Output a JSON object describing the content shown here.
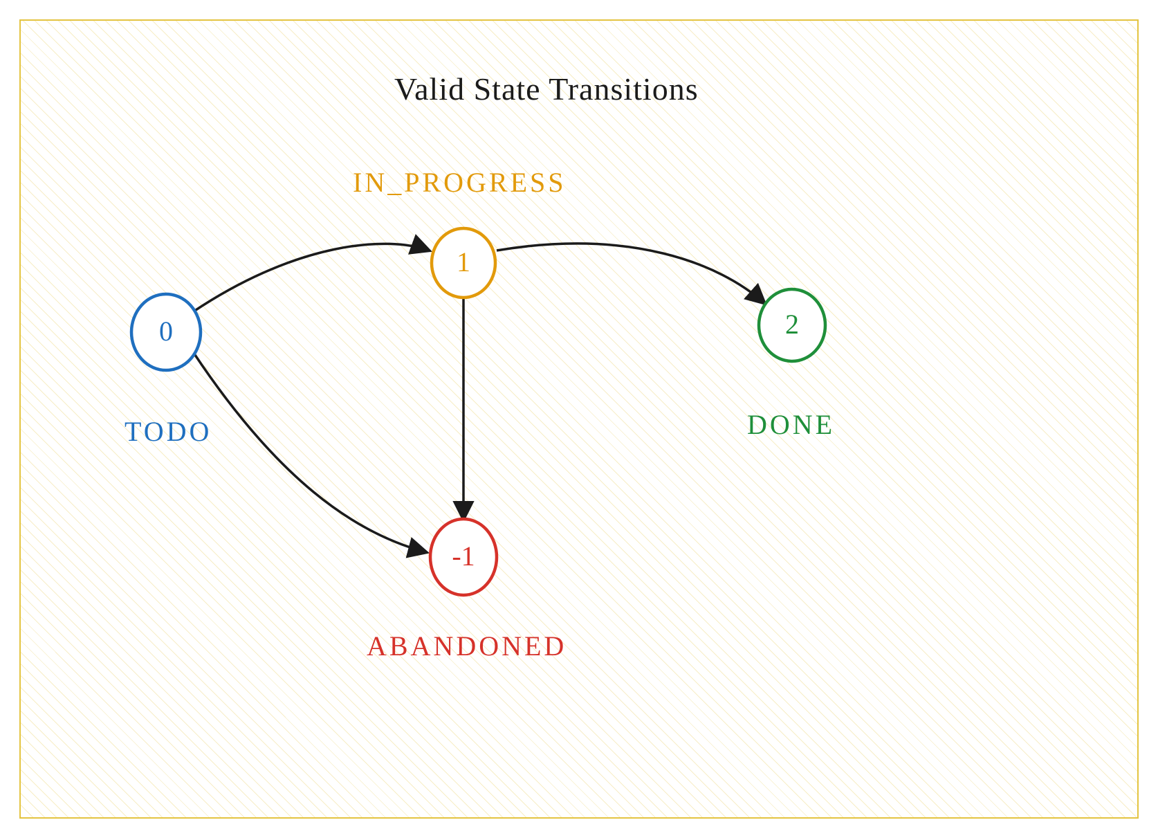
{
  "title": "Valid State Transitions",
  "nodes": {
    "todo": {
      "value": "0",
      "label": "TODO",
      "color": "#1f6fbf"
    },
    "in_progress": {
      "value": "1",
      "label": "IN_PROGRESS",
      "color": "#e29a0b"
    },
    "done": {
      "value": "2",
      "label": "DONE",
      "color": "#1f8f3a"
    },
    "abandoned": {
      "value": "-1",
      "label": "ABANDONED",
      "color": "#d6322a"
    }
  },
  "edges": [
    {
      "from": "todo",
      "to": "in_progress"
    },
    {
      "from": "in_progress",
      "to": "done"
    },
    {
      "from": "todo",
      "to": "abandoned"
    },
    {
      "from": "in_progress",
      "to": "abandoned"
    }
  ],
  "chart_data": {
    "type": "state_diagram",
    "states": [
      {
        "id": "TODO",
        "value": 0
      },
      {
        "id": "IN_PROGRESS",
        "value": 1
      },
      {
        "id": "DONE",
        "value": 2
      },
      {
        "id": "ABANDONED",
        "value": -1
      }
    ],
    "transitions": [
      {
        "from": "TODO",
        "to": "IN_PROGRESS"
      },
      {
        "from": "IN_PROGRESS",
        "to": "DONE"
      },
      {
        "from": "TODO",
        "to": "ABANDONED"
      },
      {
        "from": "IN_PROGRESS",
        "to": "ABANDONED"
      }
    ],
    "title": "Valid State Transitions"
  }
}
